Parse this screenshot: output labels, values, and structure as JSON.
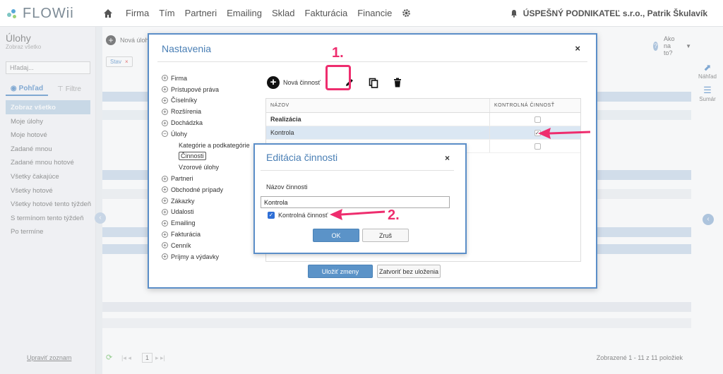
{
  "app": {
    "logo_text": "FLOWii",
    "colors": {
      "accent": "#4a86c5",
      "annotation": "#ee2d6e",
      "dialog_border": "#5b8ec8"
    }
  },
  "topnav": {
    "home_icon": "home-icon",
    "items": [
      "Firma",
      "Tím",
      "Partneri",
      "Emailing",
      "Sklad",
      "Fakturácia",
      "Financie"
    ],
    "settings_icon": "gear-icon",
    "bell_icon": "bell-icon",
    "company_user": "ÚSPEŠNÝ PODNIKATEĽ s.r.o., Patrik Škulavík"
  },
  "sidebar": {
    "title": "Úlohy",
    "subtitle": "Zobraz všetko",
    "search_placeholder": "Hľadaj...",
    "tabs": [
      {
        "label": "Pohľad",
        "active": true
      },
      {
        "label": "Filtre",
        "active": false
      }
    ],
    "items": [
      "Zobraz všetko",
      "Moje úlohy",
      "Moje hotové",
      "Zadané mnou",
      "Zadané mnou hotové",
      "Všetky čakajúce",
      "Všetky hotové",
      "Všetky hotové tento týždeň",
      "S termínom tento týždeň",
      "Po termíne"
    ],
    "active_item": "Zobraz všetko",
    "footer_link": "Upraviť zoznam"
  },
  "main": {
    "new_task_label": "Nová úloha",
    "filter_chip": "Stav",
    "help_label": "Ako na to?"
  },
  "rightpanel": {
    "preview_label": "Náhľad",
    "summary_label": "Sumár"
  },
  "pager": {
    "page": "1",
    "summary": "Zobrazené 1 - 11 z 11 položiek"
  },
  "settings_dialog": {
    "title": "Nastavenia",
    "close": "×",
    "tree": [
      {
        "label": "Firma",
        "expanded": false
      },
      {
        "label": "Prístupové práva",
        "expanded": false
      },
      {
        "label": "Číselníky",
        "expanded": false
      },
      {
        "label": "Rozšírenia",
        "expanded": false
      },
      {
        "label": "Dochádzka",
        "expanded": false
      },
      {
        "label": "Úlohy",
        "expanded": true,
        "children": [
          "Kategórie a podkategórie",
          "Činnosti",
          "Vzorové úlohy"
        ]
      },
      {
        "label": "Partneri",
        "expanded": false
      },
      {
        "label": "Obchodné prípady",
        "expanded": false
      },
      {
        "label": "Zákazky",
        "expanded": false
      },
      {
        "label": "Udalosti",
        "expanded": false
      },
      {
        "label": "Emailing",
        "expanded": false
      },
      {
        "label": "Fakturácia",
        "expanded": false
      },
      {
        "label": "Cenník",
        "expanded": false
      },
      {
        "label": "Príjmy a výdavky",
        "expanded": false
      }
    ],
    "selected_child": "Činnosti",
    "toolbar": {
      "add_label": "Nová činnosť"
    },
    "table": {
      "columns": [
        "NÁZOV",
        "KONTROLNÁ ČINNOSŤ"
      ],
      "rows": [
        {
          "name": "Realizácia",
          "checked": false,
          "bold": true
        },
        {
          "name": "Kontrola",
          "checked": true,
          "selected": true
        },
        {
          "name": "",
          "checked": false
        }
      ]
    },
    "save_label": "Uložiť zmeny",
    "close_nosave_label": "Zatvoriť bez uloženia"
  },
  "edit_dialog": {
    "title": "Editácia činnosti",
    "close": "×",
    "field_label": "Názov činnosti",
    "field_value": "Kontrola",
    "checkbox_label": "Kontrolná činnosť",
    "checkbox_checked": true,
    "ok_label": "OK",
    "cancel_label": "Zruš"
  },
  "annotations": {
    "step1": "1.",
    "step2": "2."
  }
}
